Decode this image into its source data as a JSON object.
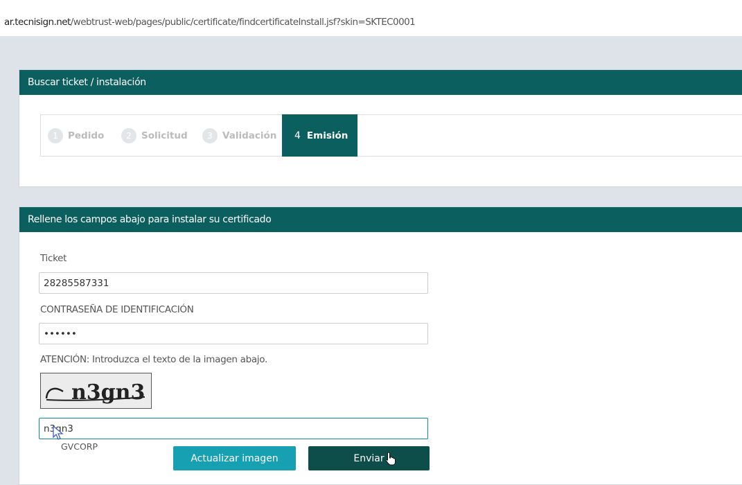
{
  "browser": {
    "url_host": "ar.tecnisign.net",
    "url_path": "/webtrust-web/pages/public/certificate/findcertificateInstall.jsf?skin=SKTEC0001"
  },
  "search_panel": {
    "title": "Buscar ticket / instalación",
    "steps": [
      {
        "num": "1",
        "label": "Pedido",
        "active": false
      },
      {
        "num": "2",
        "label": "Solicitud",
        "active": false
      },
      {
        "num": "3",
        "label": "Validación",
        "active": false
      },
      {
        "num": "4",
        "label": "Emisión",
        "active": true
      }
    ]
  },
  "install_panel": {
    "title": "Rellene los campos abajo para instalar su certificado",
    "ticket_label": "Ticket",
    "ticket_value": "28285587331",
    "password_label": "CONTRASEÑA DE IDENTIFICACIÓN",
    "password_value": "123456",
    "captcha_instruction": "ATENCIÓN: Introduzca el texto de la imagen abajo.",
    "captcha_image_text": "n3gn3",
    "captcha_value": "n3gn3",
    "watermark": "GVCORP",
    "refresh_button": "Actualizar imagen",
    "send_button": "Enviar"
  },
  "colors": {
    "header_teal": "#0b5f5e",
    "refresh_button": "#16a0b2",
    "send_button": "#0d4e4b",
    "page_background": "#dde3e9"
  }
}
